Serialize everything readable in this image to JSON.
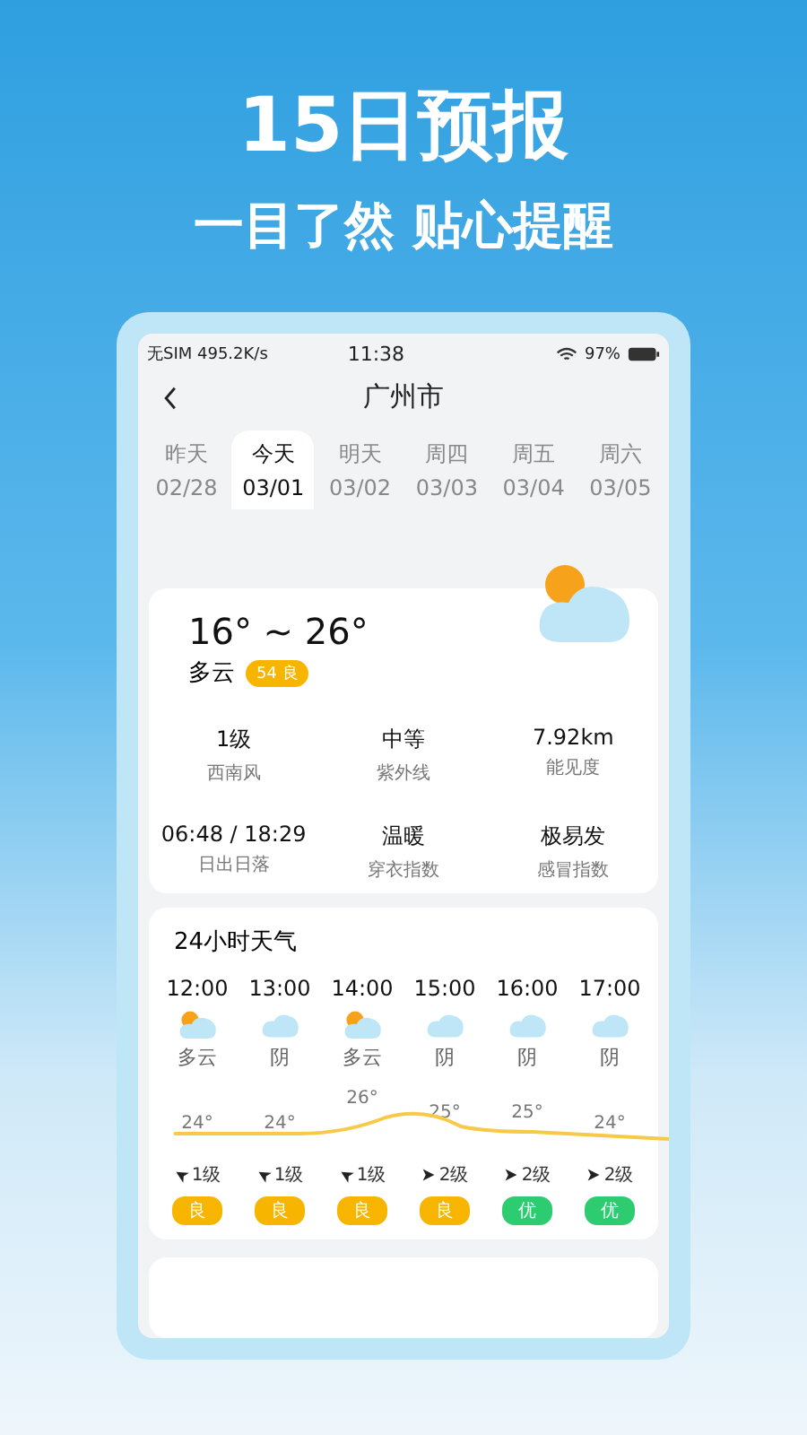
{
  "headline": "15日预报",
  "subtitle": "一目了然 贴心提醒",
  "status_bar": {
    "carrier": "无SIM 495.2K/s",
    "time": "11:38",
    "battery": "97%"
  },
  "nav": {
    "title": "广州市"
  },
  "days": [
    {
      "name": "昨天",
      "date": "02/28",
      "selected": false
    },
    {
      "name": "今天",
      "date": "03/01",
      "selected": true
    },
    {
      "name": "明天",
      "date": "03/02",
      "selected": false
    },
    {
      "name": "周四",
      "date": "03/03",
      "selected": false
    },
    {
      "name": "周五",
      "date": "03/04",
      "selected": false
    },
    {
      "name": "周六",
      "date": "03/05",
      "selected": false
    }
  ],
  "today": {
    "temp_range": "16° ~ 26°",
    "condition": "多云",
    "aqi": "54 良",
    "stats": [
      {
        "value": "1级",
        "label": "西南风"
      },
      {
        "value": "中等",
        "label": "紫外线"
      },
      {
        "value": "7.92km",
        "label": "能见度"
      },
      {
        "value": "06:48 / 18:29",
        "label": "日出日落"
      },
      {
        "value": "温暖",
        "label": "穿衣指数"
      },
      {
        "value": "极易发",
        "label": "感冒指数"
      }
    ]
  },
  "hourly": {
    "title": "24小时天气",
    "hours": [
      {
        "time": "12:00",
        "kind": "partly",
        "condition": "多云",
        "temp": "24°",
        "wind": {
          "kind": "upleft",
          "text": "1级"
        },
        "aqi": "良",
        "color": "#f7b500"
      },
      {
        "time": "13:00",
        "kind": "overcast",
        "condition": "阴",
        "temp": "24°",
        "wind": {
          "kind": "upleft",
          "text": "1级"
        },
        "aqi": "良",
        "color": "#f7b500"
      },
      {
        "time": "14:00",
        "kind": "partly",
        "condition": "多云",
        "temp": "26°",
        "wind": {
          "kind": "upleft",
          "text": "1级"
        },
        "aqi": "良",
        "color": "#f7b500"
      },
      {
        "time": "15:00",
        "kind": "overcast",
        "condition": "阴",
        "temp": "25°",
        "wind": {
          "kind": "right",
          "text": "2级"
        },
        "aqi": "良",
        "color": "#f7b500"
      },
      {
        "time": "16:00",
        "kind": "overcast",
        "condition": "阴",
        "temp": "25°",
        "wind": {
          "kind": "right",
          "text": "2级"
        },
        "aqi": "优",
        "color": "#2ecc71"
      },
      {
        "time": "17:00",
        "kind": "overcast",
        "condition": "阴",
        "temp": "24°",
        "wind": {
          "kind": "right",
          "text": "2级"
        },
        "aqi": "优",
        "color": "#2ecc71"
      }
    ]
  }
}
